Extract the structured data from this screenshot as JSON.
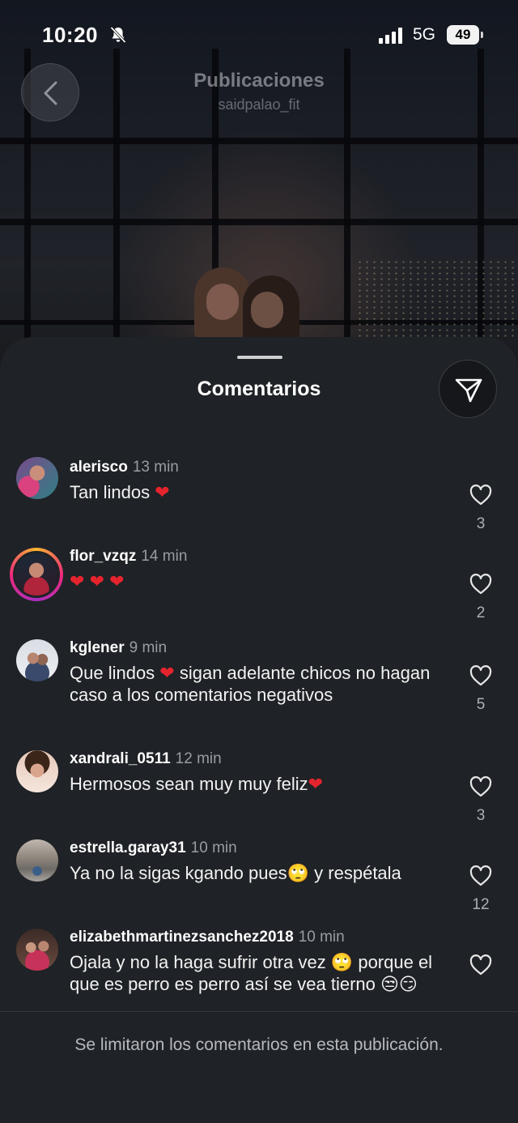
{
  "status_bar": {
    "time": "10:20",
    "network": "5G",
    "battery": "49"
  },
  "header": {
    "title": "Publicaciones",
    "subtitle": "saidpalao_fit"
  },
  "sheet": {
    "title": "Comentarios"
  },
  "comments": [
    {
      "username": "alerisco",
      "time": "13 min",
      "text": "Tan lindos ❤️",
      "likes": "3"
    },
    {
      "username": "flor_vzqz",
      "time": "14 min",
      "text": "❤️ ❤️ ❤️",
      "likes": "2"
    },
    {
      "username": "kglener",
      "time": "9 min",
      "text": "Que lindos ❤️ sigan adelante chicos no hagan caso a los comentarios negativos",
      "likes": "5"
    },
    {
      "username": "xandrali_0511",
      "time": "12 min",
      "text": "Hermosos sean muy muy feliz❤️",
      "likes": "3"
    },
    {
      "username": "estrella.garay31",
      "time": "10 min",
      "text": "Ya no la sigas kgando pues🙄 y respétala",
      "likes": "12"
    },
    {
      "username": "elizabethmartinezsanchez2018",
      "time": "10 min",
      "text": "Ojala y no la haga sufrir otra vez 🙄 porque el que es perro es perro así se vea tierno 😒😏",
      "likes": ""
    }
  ],
  "footer": {
    "note": "Se limitaron los comentarios en esta publicación."
  },
  "colors": {
    "sheet_bg": "#1f2226",
    "heart_red": "#e5242e",
    "muted_text": "#9a9ca3"
  }
}
